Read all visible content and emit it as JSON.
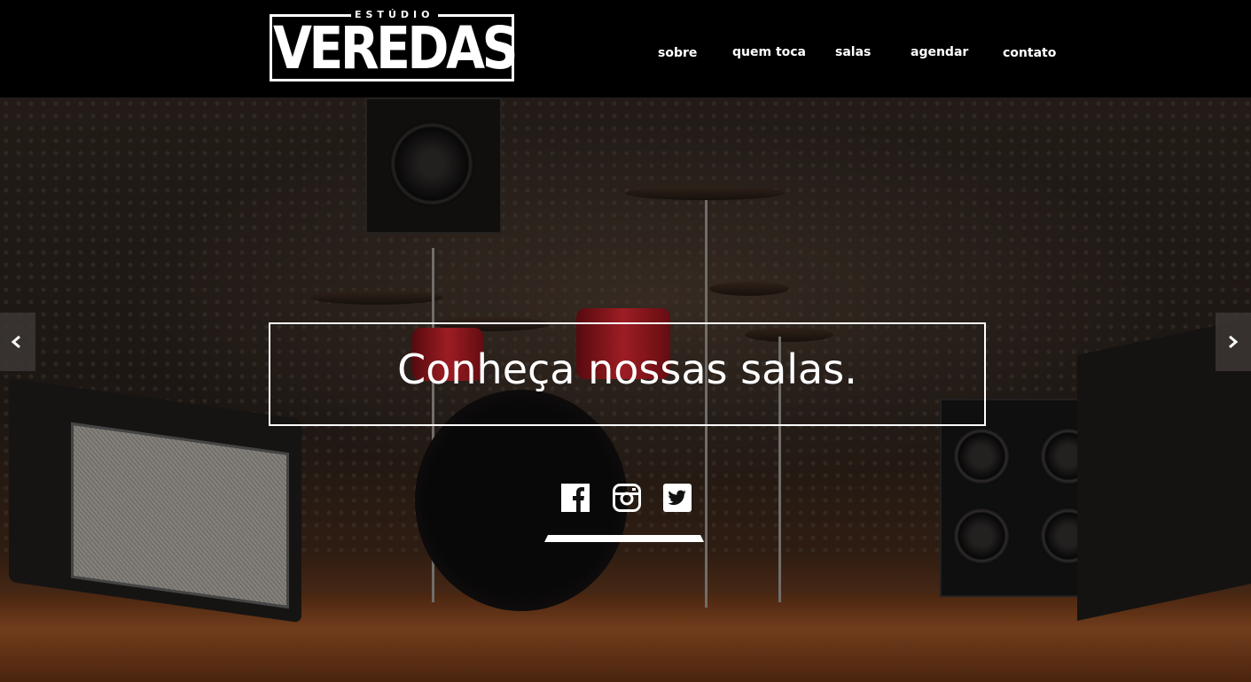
{
  "logo": {
    "small": "ESTÚDIO",
    "big": "VEREDAS"
  },
  "nav": {
    "items": [
      {
        "label": "sobre"
      },
      {
        "label": "quem toca"
      },
      {
        "label": "salas"
      },
      {
        "label": "agendar"
      },
      {
        "label": "contato"
      }
    ]
  },
  "hero": {
    "caption": "Conheça nossas salas."
  },
  "social": {
    "icons": [
      "facebook-icon",
      "instagram-icon",
      "twitter-icon"
    ]
  },
  "slider": {
    "prev_icon": "chevron-left-icon",
    "next_icon": "chevron-right-icon"
  },
  "colors": {
    "header_bg": "#000000",
    "text": "#ffffff"
  }
}
